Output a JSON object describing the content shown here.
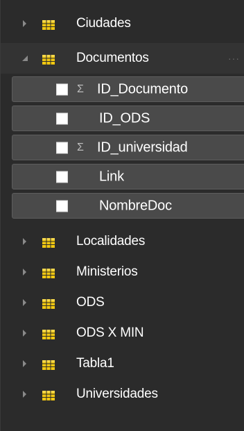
{
  "panel": {
    "tables_before": [
      {
        "label": "Ciudades",
        "expanded": false,
        "icon": "table-icon"
      }
    ],
    "expanded_table": {
      "label": "Documentos",
      "more_label": "···",
      "fields": [
        {
          "label": "ID_Documento",
          "summarized": true,
          "sigma": "Σ"
        },
        {
          "label": "ID_ODS",
          "summarized": false
        },
        {
          "label": "ID_universidad",
          "summarized": true,
          "sigma": "Σ"
        },
        {
          "label": "Link",
          "summarized": false
        },
        {
          "label": "NombreDoc",
          "summarized": false
        }
      ]
    },
    "tables_after": [
      {
        "label": "Localidades",
        "expanded": false,
        "icon": "table-icon"
      },
      {
        "label": "Ministerios",
        "expanded": false,
        "icon": "table-icon"
      },
      {
        "label": "ODS",
        "expanded": false,
        "icon": "table-icon"
      },
      {
        "label": "ODS X MIN",
        "expanded": false,
        "icon": "table-icon"
      },
      {
        "label": "Tabla1",
        "expanded": false,
        "icon": "table-icon"
      },
      {
        "label": "Universidades",
        "expanded": false,
        "icon": "table-icon"
      }
    ]
  },
  "colors": {
    "background": "#2b2b2b",
    "field_background": "#4a4a4a",
    "text": "#ffffff",
    "icon_yellow": "#f2c811",
    "chevron": "#8a8a8a"
  }
}
